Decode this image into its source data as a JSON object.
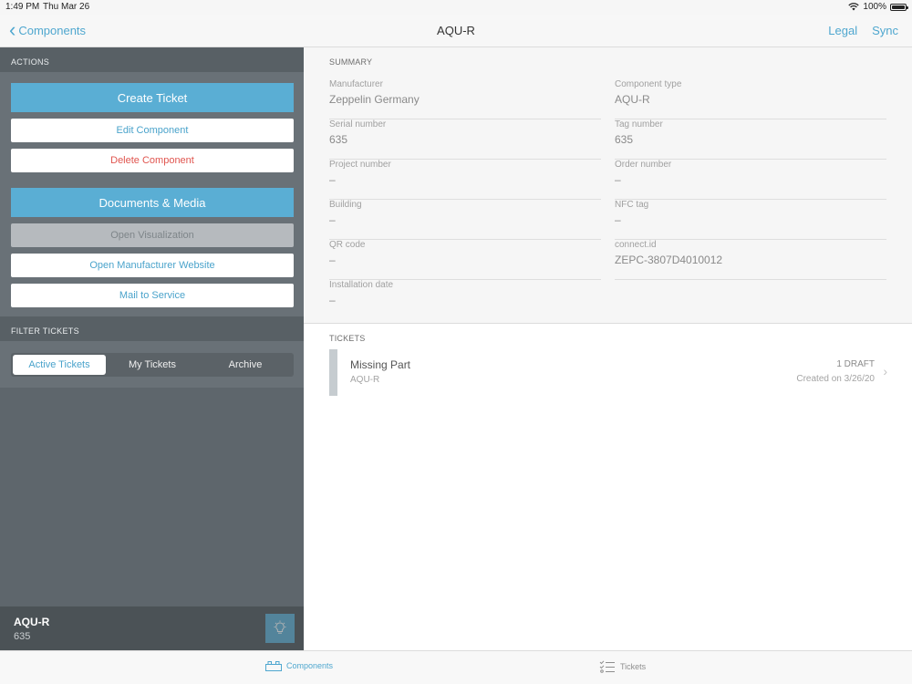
{
  "status": {
    "time": "1:49 PM",
    "date": "Thu Mar 26",
    "battery": "100%"
  },
  "nav": {
    "back_label": "Components",
    "title": "AQU-R",
    "legal": "Legal",
    "sync": "Sync"
  },
  "sidebar": {
    "actions_label": "ACTIONS",
    "create_ticket": "Create Ticket",
    "edit_component": "Edit Component",
    "delete_component": "Delete Component",
    "documents_media": "Documents & Media",
    "open_visualization": "Open Visualization",
    "open_manufacturer_website": "Open Manufacturer Website",
    "mail_to_service": "Mail to Service",
    "filter_label": "FILTER TICKETS",
    "filters": [
      "Active Tickets",
      "My Tickets",
      "Archive"
    ],
    "footer_title": "AQU-R",
    "footer_sub": "635"
  },
  "summary": {
    "label": "SUMMARY",
    "fields": [
      {
        "key": "Manufacturer",
        "value": "Zeppelin Germany"
      },
      {
        "key": "Component type",
        "value": "AQU-R"
      },
      {
        "key": "Serial number",
        "value": "635"
      },
      {
        "key": "Tag number",
        "value": "635"
      },
      {
        "key": "Project number",
        "value": "–"
      },
      {
        "key": "Order number",
        "value": "–"
      },
      {
        "key": "Building",
        "value": "–"
      },
      {
        "key": "NFC tag",
        "value": "–"
      },
      {
        "key": "QR code",
        "value": "–"
      },
      {
        "key": "connect.id",
        "value": "ZEPC-3807D4010012"
      },
      {
        "key": "Installation date",
        "value": "–"
      }
    ]
  },
  "tickets": {
    "label": "TICKETS",
    "items": [
      {
        "title": "Missing Part",
        "sub": "AQU-R",
        "status": "1 DRAFT",
        "date": "Created on 3/26/20"
      }
    ]
  },
  "tabbar": {
    "components": "Components",
    "tickets": "Tickets"
  },
  "colors": {
    "accent": "#4fa7cf",
    "primary_button": "#5aaed4",
    "danger": "#e0554f",
    "sidebar": "#5e666c"
  }
}
